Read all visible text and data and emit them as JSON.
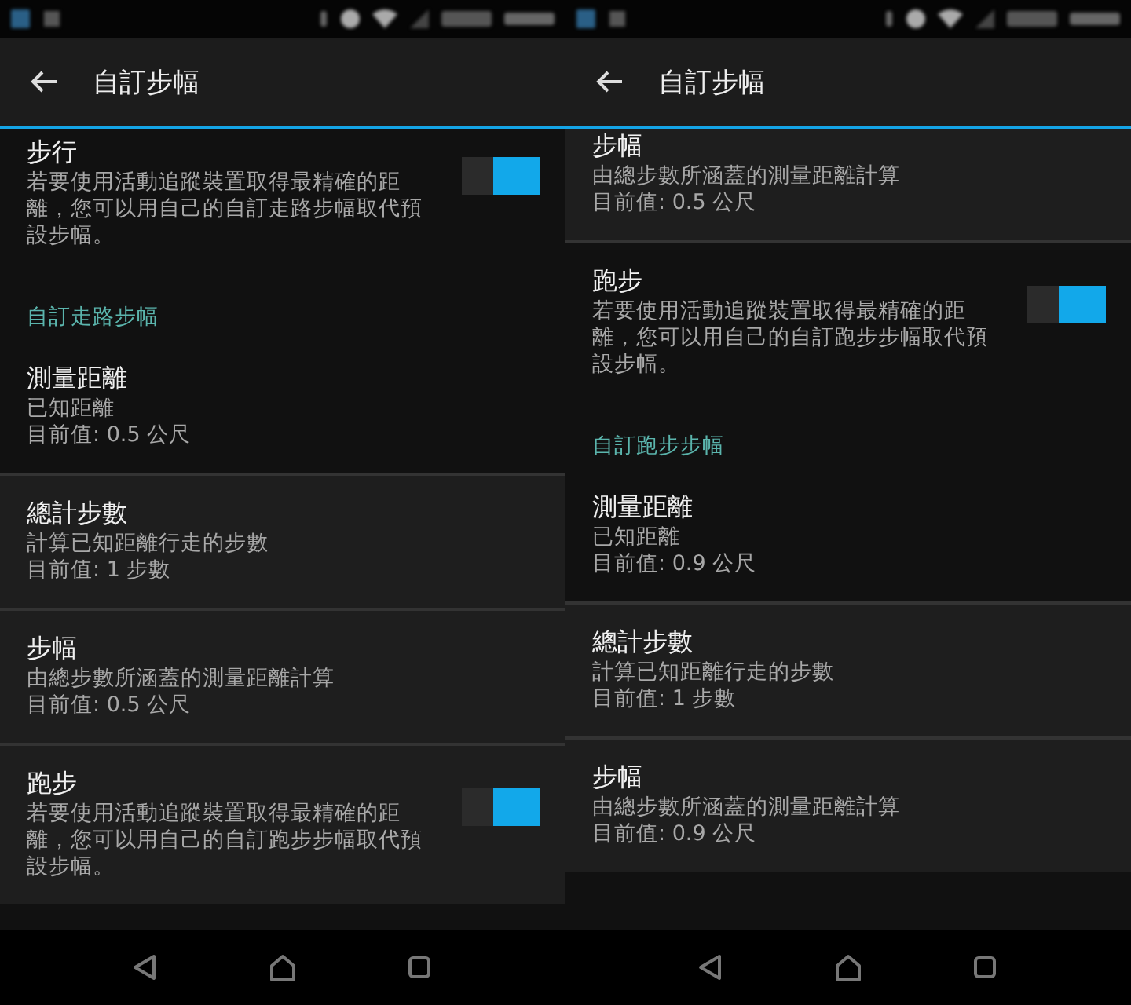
{
  "screens": [
    {
      "title": "自訂步幅",
      "scrolled": false,
      "items": [
        {
          "kind": "switch",
          "title": "步行",
          "summary": [
            "若要使用活動追蹤裝置取得最精確的距離，您可以用自己的自訂走路步幅取代預設步幅。"
          ],
          "checked": true,
          "shaded": false
        },
        {
          "kind": "header",
          "title": "自訂走路步幅"
        },
        {
          "kind": "item",
          "title": "測量距離",
          "summary": [
            "已知距離",
            "目前值: 0.5 公尺"
          ],
          "shaded": false
        },
        {
          "kind": "item",
          "title": "總計步數",
          "summary": [
            "計算已知距離行走的步數",
            "目前值: 1 步數"
          ],
          "shaded": true
        },
        {
          "kind": "item",
          "title": "步幅",
          "summary": [
            "由總步數所涵蓋的測量距離計算",
            "目前值: 0.5 公尺"
          ],
          "shaded": true
        },
        {
          "kind": "switch",
          "title": "跑步",
          "summary": [
            "若要使用活動追蹤裝置取得最精確的距離，您可以用自己的自訂跑步步幅取代預設步幅。"
          ],
          "checked": true,
          "shaded": true
        }
      ]
    },
    {
      "title": "自訂步幅",
      "scrolled": true,
      "items": [
        {
          "kind": "item",
          "title": "步幅",
          "summary": [
            "由總步數所涵蓋的測量距離計算",
            "目前值: 0.5 公尺"
          ],
          "shaded": true
        },
        {
          "kind": "switch",
          "title": "跑步",
          "summary": [
            "若要使用活動追蹤裝置取得最精確的距離，您可以用自己的自訂跑步步幅取代預設步幅。"
          ],
          "checked": true,
          "shaded": false
        },
        {
          "kind": "header",
          "title": "自訂跑步步幅"
        },
        {
          "kind": "item",
          "title": "測量距離",
          "summary": [
            "已知距離",
            "目前值: 0.9 公尺"
          ],
          "shaded": false
        },
        {
          "kind": "item",
          "title": "總計步數",
          "summary": [
            "計算已知距離行走的步數",
            "目前值: 1 步數"
          ],
          "shaded": true
        },
        {
          "kind": "item",
          "title": "步幅",
          "summary": [
            "由總步數所涵蓋的測量距離計算",
            "目前值: 0.9 公尺"
          ],
          "shaded": true
        }
      ]
    }
  ]
}
